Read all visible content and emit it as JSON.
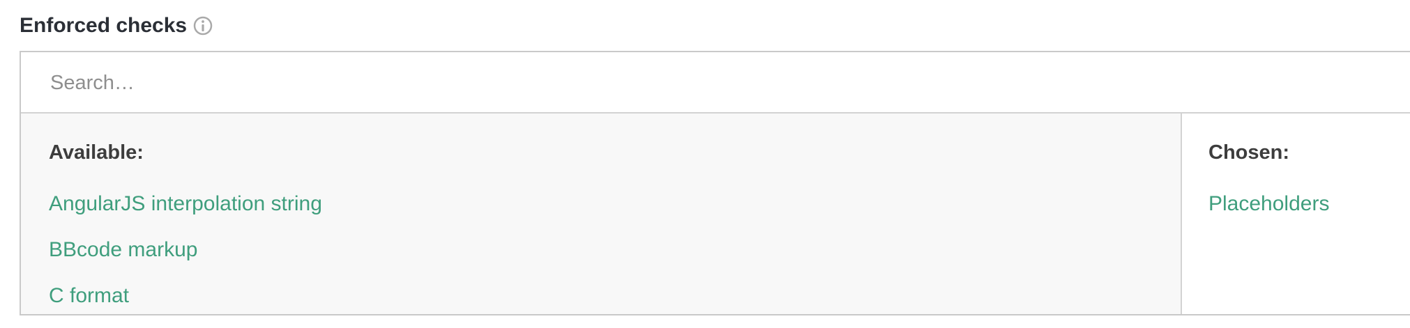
{
  "field": {
    "label": "Enforced checks",
    "info_icon": "info-icon"
  },
  "search": {
    "placeholder": "Search…",
    "value": ""
  },
  "available": {
    "heading": "Available:",
    "items": [
      "AngularJS interpolation string",
      "BBcode markup",
      "C format"
    ]
  },
  "chosen": {
    "heading": "Chosen:",
    "items": [
      "Placeholders"
    ]
  },
  "colors": {
    "link": "#3f9e7d",
    "available_bg": "#f8f8f8",
    "border": "#c9c9c9"
  }
}
